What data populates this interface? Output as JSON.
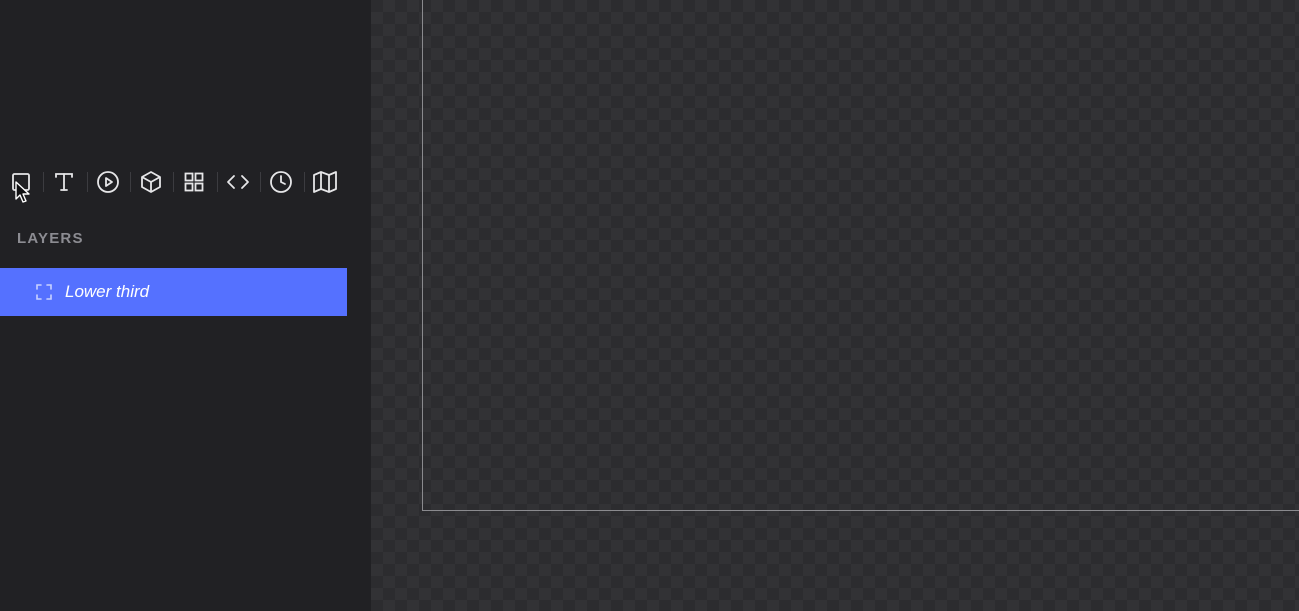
{
  "toolbar": {
    "tools": [
      {
        "name": "frame-tool",
        "icon": "frame-icon"
      },
      {
        "name": "text-tool",
        "icon": "text-icon"
      },
      {
        "name": "video-tool",
        "icon": "play-circle-icon"
      },
      {
        "name": "3d-tool",
        "icon": "cube-icon"
      },
      {
        "name": "grid-tool",
        "icon": "grid-icon"
      },
      {
        "name": "code-tool",
        "icon": "code-icon"
      },
      {
        "name": "clock-tool",
        "icon": "clock-icon"
      },
      {
        "name": "map-tool",
        "icon": "map-icon"
      }
    ]
  },
  "layers": {
    "heading": "LAYERS",
    "items": [
      {
        "label": "Lower third",
        "icon": "frame-corners-icon",
        "selected": true
      }
    ]
  },
  "colors": {
    "sidebar_bg": "#212124",
    "selected_layer": "#5571ff",
    "canvas_bg": "#2c2c2f"
  }
}
